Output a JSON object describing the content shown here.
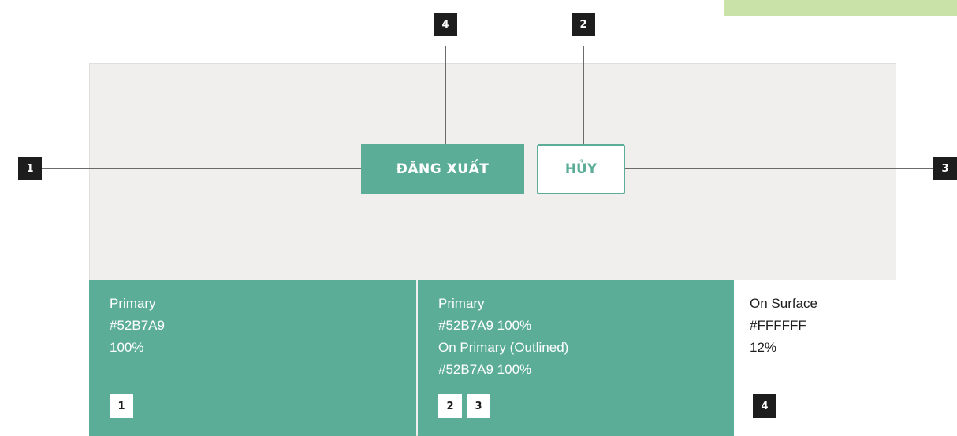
{
  "buttons": {
    "primary_label": "ĐĂNG XUẤT",
    "outlined_label": "HỦY"
  },
  "callouts": {
    "top_left": "4",
    "top_right": "2",
    "left": "1",
    "right": "3"
  },
  "specs": [
    {
      "lines": [
        "Primary",
        "#52B7A9",
        "100%"
      ],
      "chips": [
        "1"
      ]
    },
    {
      "lines": [
        "Primary",
        "#52B7A9 100%",
        "On Primary (Outlined)",
        "#52B7A9 100%"
      ],
      "chips": [
        "2",
        "3"
      ]
    },
    {
      "lines": [
        "On Surface",
        "#FFFFFF",
        "12%"
      ],
      "chips": [
        "4"
      ]
    }
  ],
  "colors": {
    "primary": "#52B7A9",
    "surface_bg": "#F0EFED",
    "badge": "#1D1D1D",
    "accent_tag": "#C9E2A8"
  },
  "icons": []
}
